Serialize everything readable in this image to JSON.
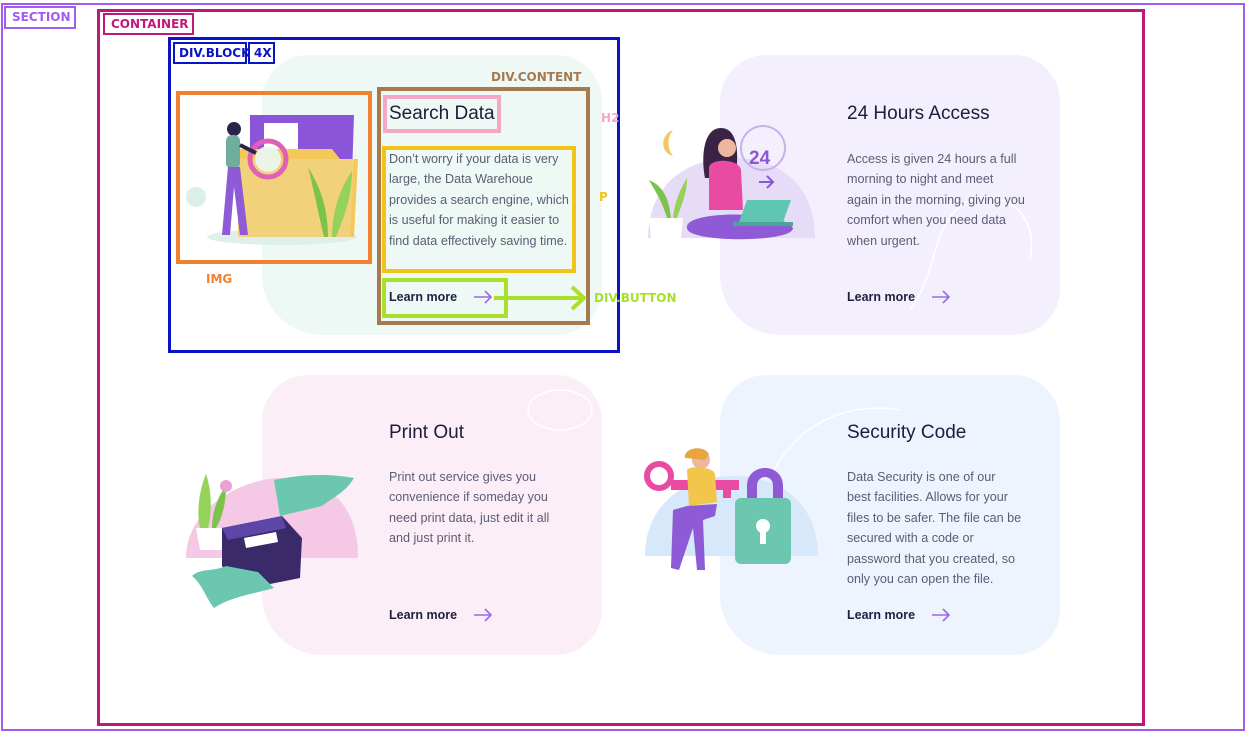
{
  "annotations": {
    "section": "SECTION",
    "container": "CONTAINER",
    "div_block": "DIV.BLOCK",
    "multiplier": "4X",
    "div_content": "DIV.CONTENT",
    "h2": "H2",
    "p": "P",
    "img": "IMG",
    "div_button": "DIV.BUTTON"
  },
  "colors": {
    "section": "#a35cf0",
    "container": "#c01878",
    "block": "#0b14c4",
    "content": "#a8784e",
    "h2": "#f4a8c8",
    "p": "#f2c417",
    "img": "#f0812e",
    "button": "#a9e02a",
    "accent": "#9a6ae6"
  },
  "cards": [
    {
      "title": "Search Data",
      "body": "Don’t worry if your data is very large, the Data Warehoue provides a search engine, which is useful for making it easier to find data effectively saving time.",
      "link": "Learn more",
      "illustration": "person-with-magnifier-and-folder",
      "bg": "#eef8f5"
    },
    {
      "title": "24 Hours Access",
      "body": "Access is given 24 hours a full morning to night and  meet again in the morning, giving you comfort when  you need data when urgent.",
      "link": "Learn more",
      "illustration": "woman-with-laptop-moon-24",
      "badge": "24",
      "bg": "#f4effc"
    },
    {
      "title": "Print Out",
      "body": "Print out service gives you convenience if someday  you need print data, just edit it all and just print it.",
      "link": "Learn more",
      "illustration": "printer-with-paper",
      "bg": "#fbeef7"
    },
    {
      "title": "Security Code",
      "body": "Data Security is one of our best facilities. Allows for your files  to be safer. The file can be secured with a code or password that   you created, so only you can open the file.",
      "link": "Learn more",
      "illustration": "woman-with-key-and-padlock",
      "bg": "#edf4fd"
    }
  ]
}
